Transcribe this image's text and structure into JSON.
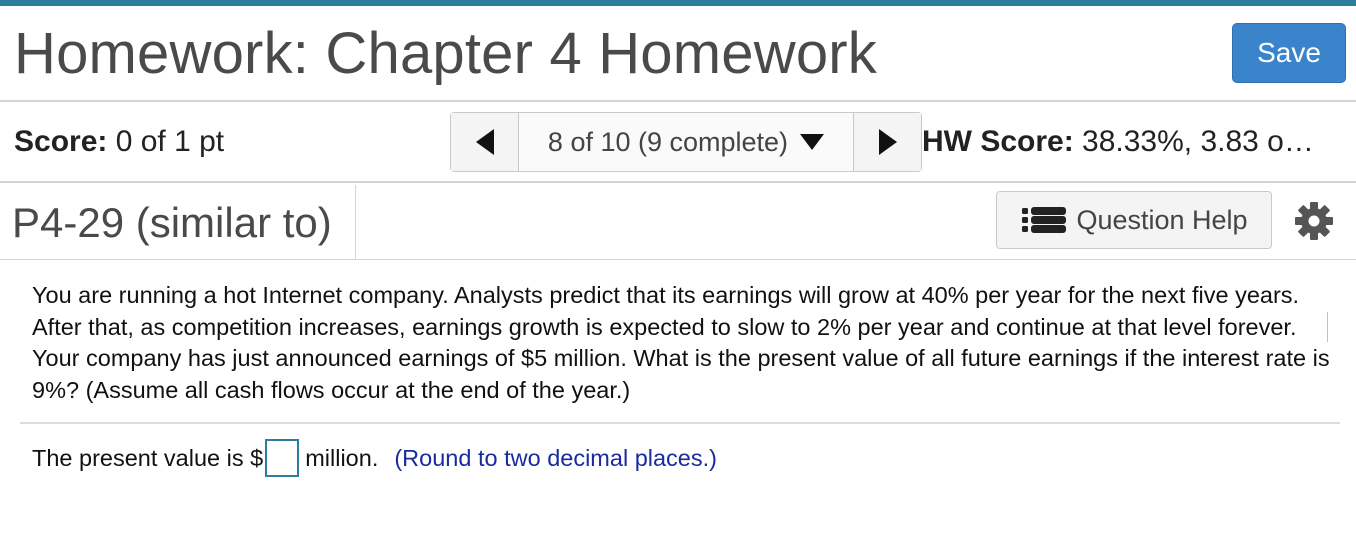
{
  "header": {
    "title": "Homework: Chapter 4 Homework",
    "save_label": "Save"
  },
  "score_bar": {
    "score_label": "Score:",
    "score_value": "0 of 1 pt",
    "nav_position": "8 of 10 (9 complete)",
    "hw_score_label": "HW Score:",
    "hw_score_value": "38.33%, 3.83 o…"
  },
  "problem": {
    "id": "P4-29 (similar to)",
    "help_label": "Question Help",
    "text": "You are running a hot Internet company. Analysts predict that its earnings will grow at 40% per year for the next five years. After that, as competition increases, earnings growth is expected to slow to 2% per year and continue at that level forever. Your company has just announced earnings of $5 million. What is the present value of all future earnings if the interest rate is 9%? (Assume all cash flows occur at the end of the year.)"
  },
  "answer": {
    "prefix": "The present value is $",
    "input_value": "",
    "suffix": "million.",
    "hint": "(Round to two decimal places.)"
  },
  "colors": {
    "accent": "#2e7d9c",
    "save_button": "#3a84cc",
    "hint_text": "#1a2aa0"
  }
}
